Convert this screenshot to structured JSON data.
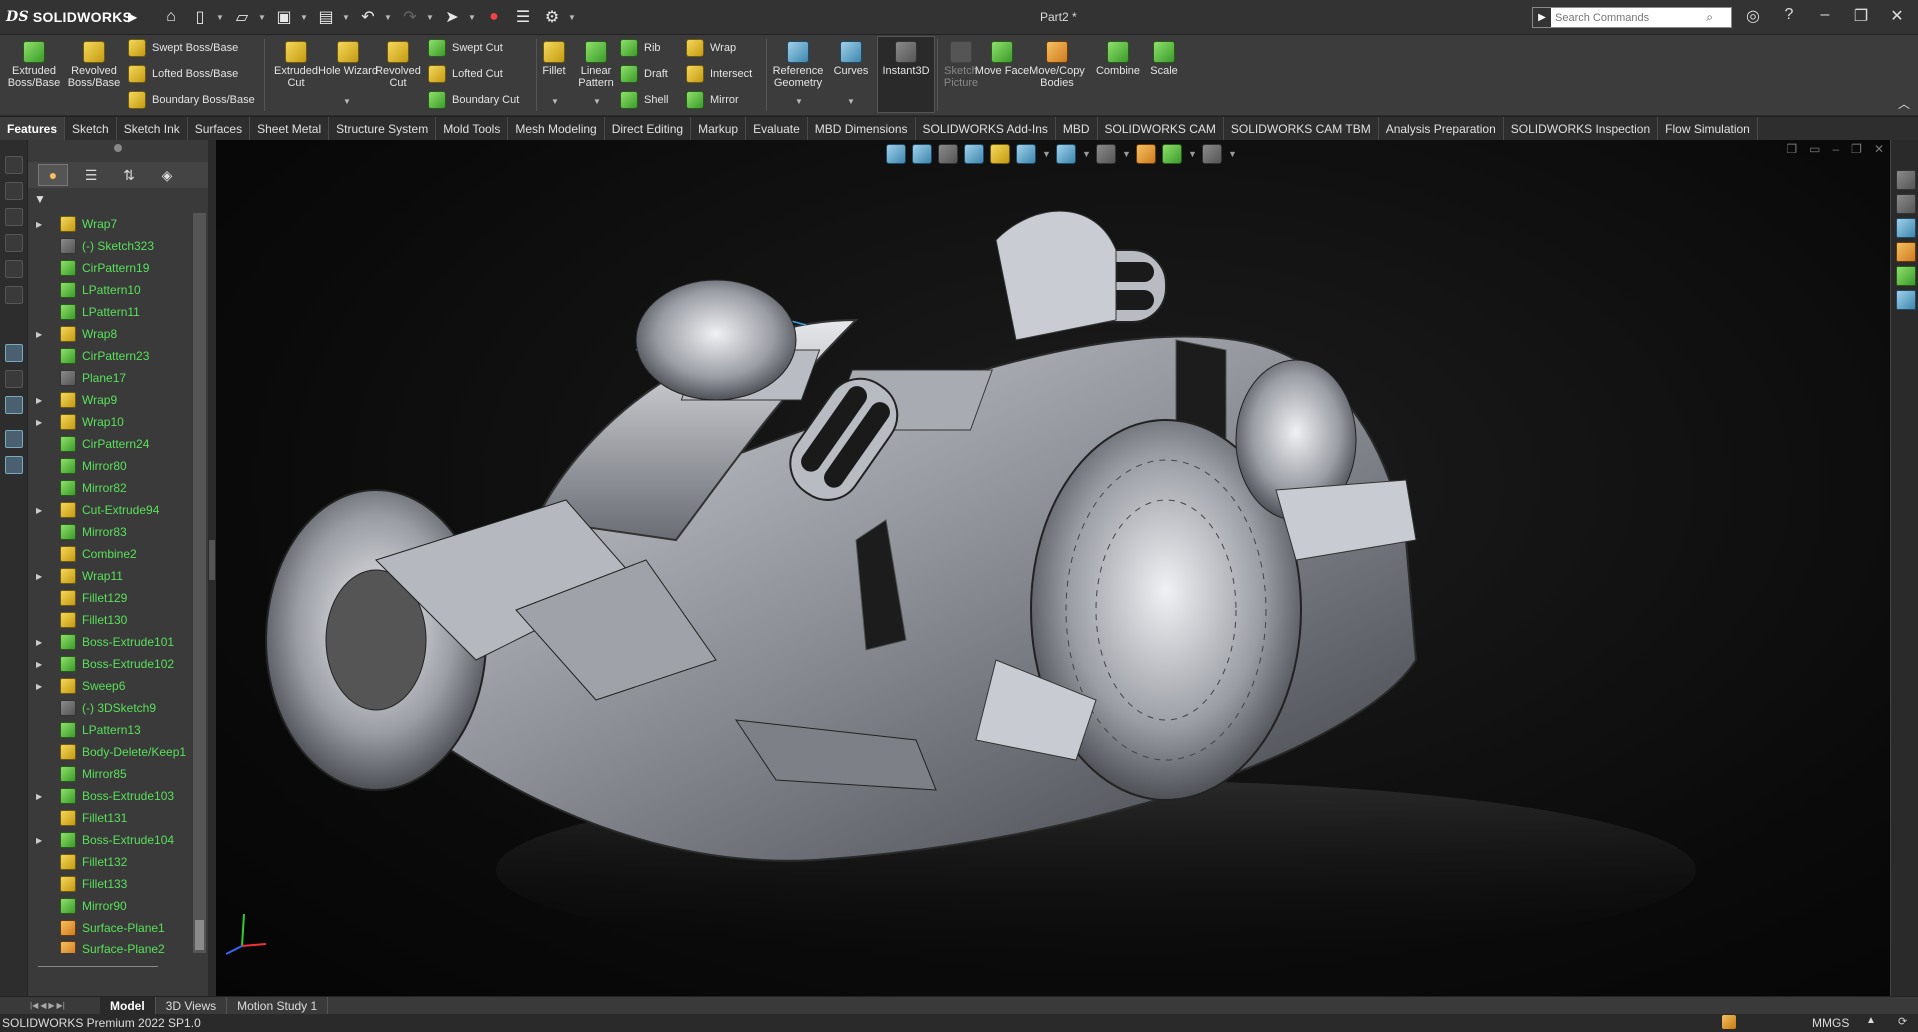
{
  "app": {
    "brand": "SOLIDWORKS",
    "document_title": "Part2 *",
    "search_placeholder": "Search Commands"
  },
  "commands": {
    "extruded_boss": "Extruded Boss/Base",
    "revolved_boss": "Revolved Boss/Base",
    "swept_boss": "Swept Boss/Base",
    "lofted_boss": "Lofted Boss/Base",
    "boundary_boss": "Boundary Boss/Base",
    "extruded_cut": "Extruded Cut",
    "hole_wizard": "Hole Wizard",
    "revolved_cut": "Revolved Cut",
    "swept_cut": "Swept Cut",
    "lofted_cut": "Lofted Cut",
    "boundary_cut": "Boundary Cut",
    "fillet": "Fillet",
    "linear_pattern": "Linear Pattern",
    "rib": "Rib",
    "draft": "Draft",
    "shell": "Shell",
    "wrap": "Wrap",
    "intersect": "Intersect",
    "mirror": "Mirror",
    "reference_geometry": "Reference Geometry",
    "curves": "Curves",
    "instant3d": "Instant3D",
    "sketch_picture": "Sketch Picture",
    "move_face": "Move Face",
    "move_copy_bodies": "Move/Copy Bodies",
    "combine": "Combine",
    "scale": "Scale"
  },
  "tabs": [
    "Features",
    "Sketch",
    "Sketch Ink",
    "Surfaces",
    "Sheet Metal",
    "Structure System",
    "Mold Tools",
    "Mesh Modeling",
    "Direct Editing",
    "Markup",
    "Evaluate",
    "MBD Dimensions",
    "SOLIDWORKS Add-Ins",
    "MBD",
    "SOLIDWORKS CAM",
    "SOLIDWORKS CAM TBM",
    "Analysis Preparation",
    "SOLIDWORKS Inspection",
    "Flow Simulation"
  ],
  "tree": [
    {
      "label": "Wrap7",
      "icon": "wrap",
      "expandable": true
    },
    {
      "label": "(-) Sketch323",
      "icon": "sketch",
      "expandable": false
    },
    {
      "label": "CirPattern19",
      "icon": "pattern",
      "expandable": false
    },
    {
      "label": "LPattern10",
      "icon": "pattern",
      "expandable": false
    },
    {
      "label": "LPattern11",
      "icon": "pattern",
      "expandable": false
    },
    {
      "label": "Wrap8",
      "icon": "wrap",
      "expandable": true
    },
    {
      "label": "CirPattern23",
      "icon": "pattern",
      "expandable": false
    },
    {
      "label": "Plane17",
      "icon": "plane",
      "expandable": false
    },
    {
      "label": "Wrap9",
      "icon": "wrap",
      "expandable": true
    },
    {
      "label": "Wrap10",
      "icon": "wrap",
      "expandable": true
    },
    {
      "label": "CirPattern24",
      "icon": "pattern",
      "expandable": false
    },
    {
      "label": "Mirror80",
      "icon": "mirror",
      "expandable": false
    },
    {
      "label": "Mirror82",
      "icon": "mirror",
      "expandable": false
    },
    {
      "label": "Cut-Extrude94",
      "icon": "cut",
      "expandable": true
    },
    {
      "label": "Mirror83",
      "icon": "mirror",
      "expandable": false
    },
    {
      "label": "Combine2",
      "icon": "combine",
      "expandable": false
    },
    {
      "label": "Wrap11",
      "icon": "wrap",
      "expandable": true
    },
    {
      "label": "Fillet129",
      "icon": "fillet",
      "expandable": false
    },
    {
      "label": "Fillet130",
      "icon": "fillet",
      "expandable": false
    },
    {
      "label": "Boss-Extrude101",
      "icon": "boss",
      "expandable": true
    },
    {
      "label": "Boss-Extrude102",
      "icon": "boss",
      "expandable": true
    },
    {
      "label": "Sweep6",
      "icon": "sweep",
      "expandable": true
    },
    {
      "label": "(-) 3DSketch9",
      "icon": "sketch3d",
      "expandable": false
    },
    {
      "label": "LPattern13",
      "icon": "pattern",
      "expandable": false
    },
    {
      "label": "Body-Delete/Keep1",
      "icon": "body",
      "expandable": false
    },
    {
      "label": "Mirror85",
      "icon": "mirror",
      "expandable": false
    },
    {
      "label": "Boss-Extrude103",
      "icon": "boss",
      "expandable": true
    },
    {
      "label": "Fillet131",
      "icon": "fillet",
      "expandable": false
    },
    {
      "label": "Boss-Extrude104",
      "icon": "boss",
      "expandable": true
    },
    {
      "label": "Fillet132",
      "icon": "fillet",
      "expandable": false
    },
    {
      "label": "Fillet133",
      "icon": "fillet",
      "expandable": false
    },
    {
      "label": "Mirror90",
      "icon": "mirror",
      "expandable": false
    },
    {
      "label": "Surface-Plane1",
      "icon": "surface",
      "expandable": false
    },
    {
      "label": "Surface-Plane2",
      "icon": "surface",
      "expandable": false
    }
  ],
  "bottom_tabs": [
    "Model",
    "3D Views",
    "Motion Study 1"
  ],
  "status": {
    "version": "SOLIDWORKS Premium 2022 SP1.0",
    "units": "MMGS"
  },
  "colors": {
    "tree_text": "#59e05a",
    "accent": "#4aa3df",
    "background": "#0a0a0a"
  }
}
